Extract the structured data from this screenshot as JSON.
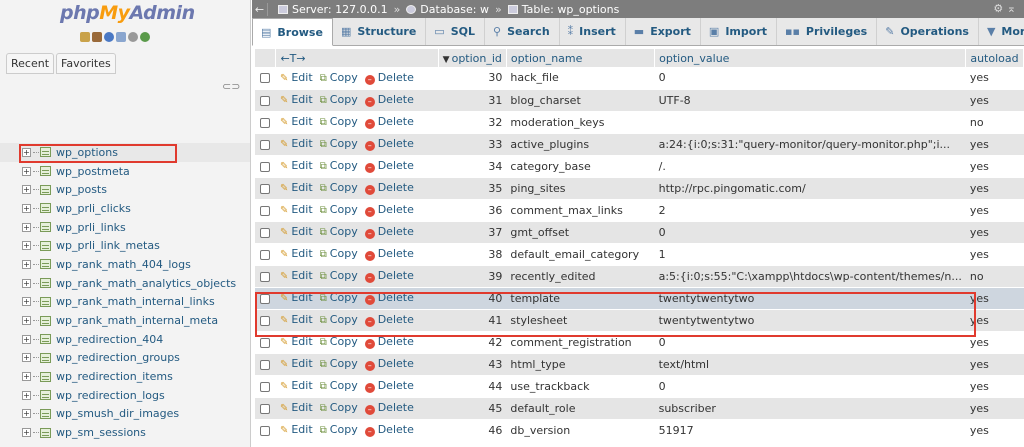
{
  "app": {
    "logo_parts": [
      "php",
      "My",
      "Admin"
    ]
  },
  "left_panel": {
    "tabs": [
      "Recent",
      "Favorites"
    ],
    "tables": [
      "wp_options",
      "wp_postmeta",
      "wp_posts",
      "wp_prli_clicks",
      "wp_prli_links",
      "wp_prli_link_metas",
      "wp_rank_math_404_logs",
      "wp_rank_math_analytics_objects",
      "wp_rank_math_internal_links",
      "wp_rank_math_internal_meta",
      "wp_redirection_404",
      "wp_redirection_groups",
      "wp_redirection_items",
      "wp_redirection_logs",
      "wp_smush_dir_images",
      "wp_sm_sessions"
    ],
    "selected_table": "wp_options"
  },
  "breadcrumb": {
    "server": "Server: 127.0.0.1",
    "database": "Database: w",
    "table": "Table: wp_options",
    "separator": "»"
  },
  "menu_tabs": [
    "Browse",
    "Structure",
    "SQL",
    "Search",
    "Insert",
    "Export",
    "Import",
    "Privileges",
    "Operations",
    "More"
  ],
  "active_tab": "Browse",
  "grid": {
    "columns": {
      "resize": "←T→",
      "option_id": "option_id",
      "option_name": "option_name",
      "option_value": "option_value",
      "autoload": "autoload"
    },
    "actions": {
      "edit": "Edit",
      "copy": "Copy",
      "delete": "Delete"
    },
    "rows": [
      {
        "id": "30",
        "name": "hack_file",
        "value": "0",
        "autoload": "yes"
      },
      {
        "id": "31",
        "name": "blog_charset",
        "value": "UTF-8",
        "autoload": "yes"
      },
      {
        "id": "32",
        "name": "moderation_keys",
        "value": "",
        "autoload": "no"
      },
      {
        "id": "33",
        "name": "active_plugins",
        "value": "a:24:{i:0;s:31:\"query-monitor/query-monitor.php\";i...",
        "autoload": "yes"
      },
      {
        "id": "34",
        "name": "category_base",
        "value": "/.",
        "autoload": "yes"
      },
      {
        "id": "35",
        "name": "ping_sites",
        "value": "http://rpc.pingomatic.com/",
        "autoload": "yes"
      },
      {
        "id": "36",
        "name": "comment_max_links",
        "value": "2",
        "autoload": "yes"
      },
      {
        "id": "37",
        "name": "gmt_offset",
        "value": "0",
        "autoload": "yes"
      },
      {
        "id": "38",
        "name": "default_email_category",
        "value": "1",
        "autoload": "yes"
      },
      {
        "id": "39",
        "name": "recently_edited",
        "value": "a:5:{i:0;s:55:\"C:\\xampp\\htdocs\\wp-content/themes/n...",
        "autoload": "no"
      },
      {
        "id": "40",
        "name": "template",
        "value": "twentytwentytwo",
        "autoload": "yes"
      },
      {
        "id": "41",
        "name": "stylesheet",
        "value": "twentytwentytwo",
        "autoload": "yes"
      },
      {
        "id": "42",
        "name": "comment_registration",
        "value": "0",
        "autoload": "yes"
      },
      {
        "id": "43",
        "name": "html_type",
        "value": "text/html",
        "autoload": "yes"
      },
      {
        "id": "44",
        "name": "use_trackback",
        "value": "0",
        "autoload": "yes"
      },
      {
        "id": "45",
        "name": "default_role",
        "value": "subscriber",
        "autoload": "yes"
      },
      {
        "id": "46",
        "name": "db_version",
        "value": "51917",
        "autoload": "yes"
      }
    ],
    "highlighted_ids": [
      "40"
    ]
  },
  "colors": {
    "highlight_box": "#e03a2e",
    "link": "#235a81",
    "topbar": "#7d7d7d"
  }
}
